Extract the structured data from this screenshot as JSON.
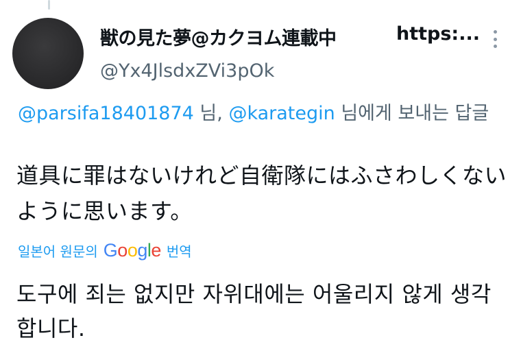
{
  "tweet": {
    "display_name": "獣の見た夢@カクヨム連載中",
    "display_name_url": "https:...",
    "handle": "@Yx4JlsdxZVi3pOk",
    "more_icon": "more-vertical-icon",
    "reply_to": {
      "mention_1": "@parsifa18401874",
      "sep_1": " 님, ",
      "mention_2": "@karategin",
      "suffix": " 님에게 보내는 답글"
    },
    "text": "道具に罪はないけれど自衛隊にはふさわしくないように思います。",
    "translation": {
      "prefix": "일본어 원문의",
      "provider": "Google",
      "suffix": "번역",
      "text": "도구에 죄는 없지만 자위대에는 어울리지 않게 생각합니다."
    }
  },
  "colors": {
    "link": "#1d9bf0",
    "secondary_text": "#536471",
    "primary_text": "#0f1419",
    "google_blue": "#4285F4",
    "google_red": "#EA4335",
    "google_yellow": "#FBBC05",
    "google_green": "#34A853"
  }
}
